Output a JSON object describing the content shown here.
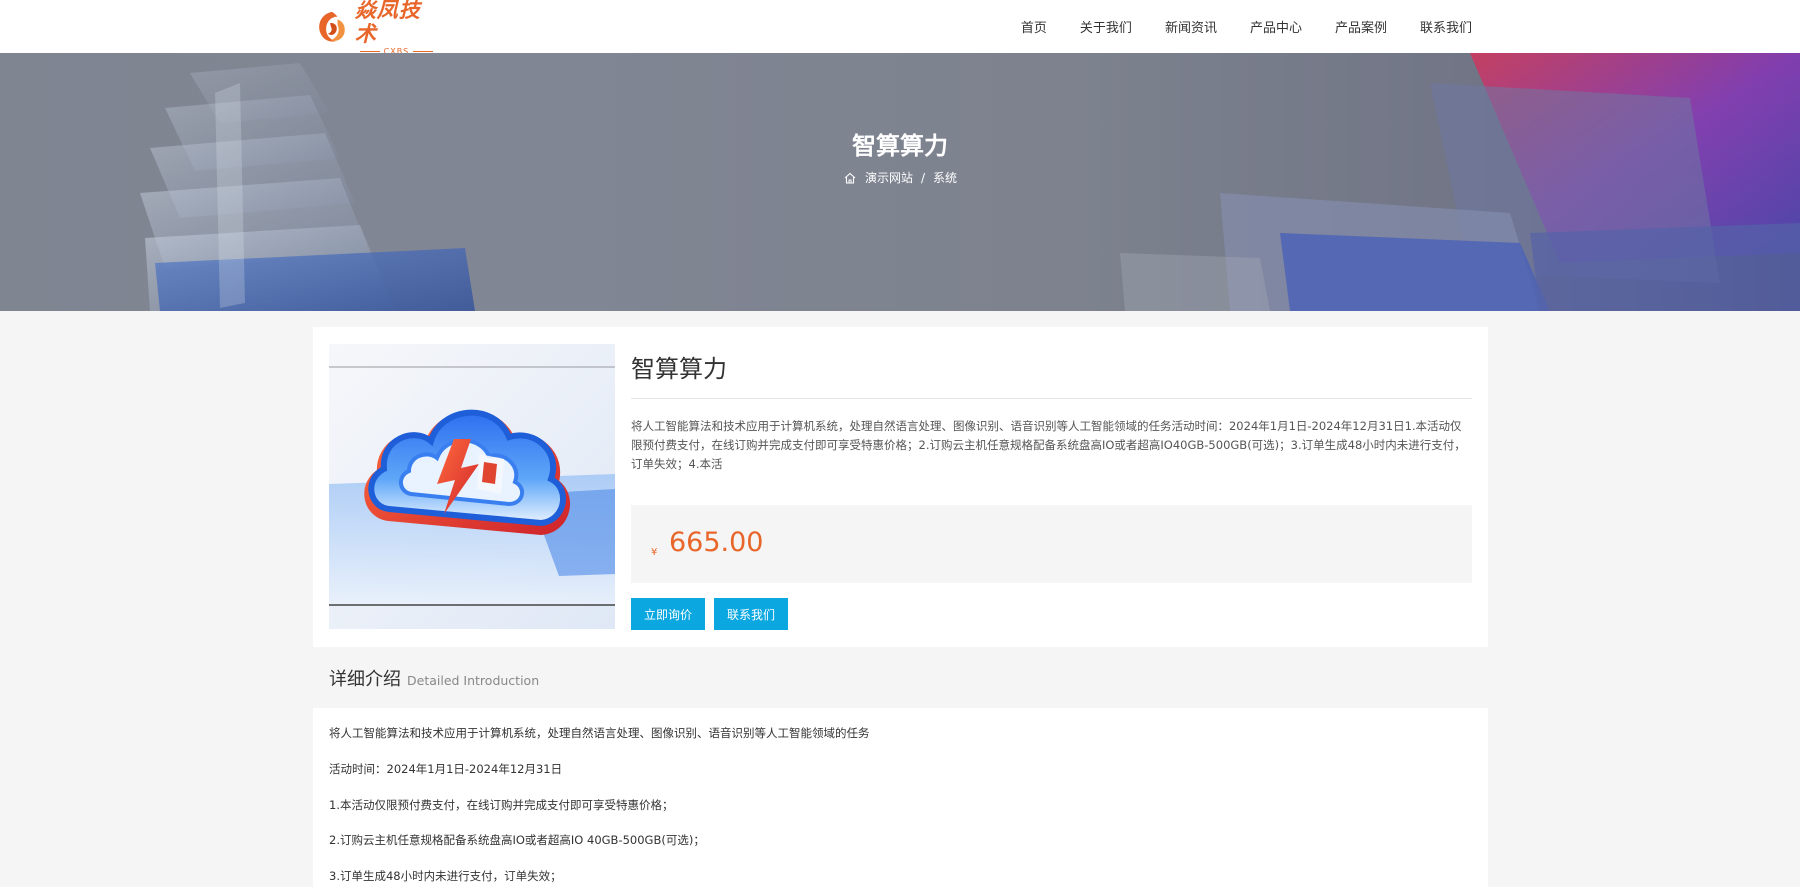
{
  "header": {
    "logo_cn": "焱凤技术",
    "logo_en": "CXBS",
    "nav": [
      "首页",
      "关于我们",
      "新闻资讯",
      "产品中心",
      "产品案例",
      "联系我们"
    ]
  },
  "banner": {
    "title": "智算算力",
    "breadcrumb": {
      "home": "演示网站",
      "separator": "/",
      "current": "系统"
    }
  },
  "product": {
    "title": "智算算力",
    "description": "将人工智能算法和技术应用于计算机系统，处理自然语言处理、图像识别、语音识别等人工智能领域的任务活动时间：2024年1月1日-2024年12月31日1.本活动仅限预付费支付，在线订购并完成支付即可享受特惠价格；2.订购云主机任意规格配备系统盘高IO或者超高IO40GB-500GB(可选)；3.订单生成48小时内未进行支付，订单失效；4.本活",
    "currency": "¥",
    "price": "665.00",
    "btn_inquiry": "立即询价",
    "btn_contact": "联系我们"
  },
  "details": {
    "title_cn": "详细介绍",
    "title_en": "Detailed Introduction",
    "lines": [
      "将人工智能算法和技术应用于计算机系统，处理自然语言处理、图像识别、语音识别等人工智能领域的任务",
      "活动时间：2024年1月1日-2024年12月31日",
      "1.本活动仅限预付费支付，在线订购并完成支付即可享受特惠价格；",
      "2.订购云主机任意规格配备系统盘高IO或者超高IO 40GB-500GB(可选)；",
      "3.订单生成48小时内未进行支付，订单失效；"
    ]
  },
  "colors": {
    "accent": "#0aa7e0",
    "price": "#e8662a",
    "brand": "#e8662a"
  },
  "icons": {
    "home": "home-icon",
    "logo": "phoenix-logo-icon",
    "product": "cloud-lightning-icon"
  }
}
